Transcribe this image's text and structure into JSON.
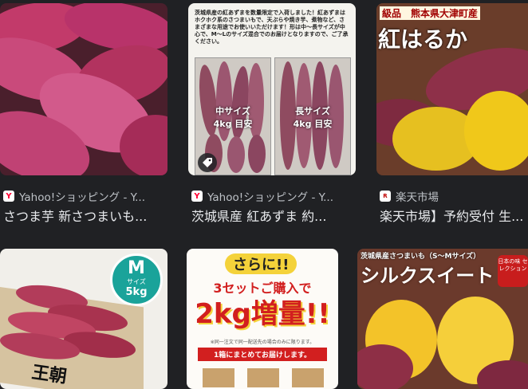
{
  "results": [
    {
      "source": "Yahoo!ショッピング - Y...",
      "source_icon": "yahoo-favicon",
      "title": "さつま芋 新さつまいも..."
    },
    {
      "source": "Yahoo!ショッピング - Y...",
      "source_icon": "yahoo-favicon",
      "title": "茨城県産 紅あずま 約...",
      "image_text": {
        "notice": "茨城県産の紅あずまを数量限定で入荷しました！紅あずまはホクホク系のさつまいもで、天ぷらや焼き芋、煮物など、さまざまな用途でお使いいただけます！形は中～長サイズが中心で、M～Lのサイズ混合でのお届けとなりますので、ご了承ください。",
        "left_label_1": "中サイズ",
        "left_label_2": "4kg 目安",
        "right_label_1": "長サイズ",
        "right_label_2": "4kg 目安"
      }
    },
    {
      "source": "楽天市場",
      "source_icon": "rakuten-favicon",
      "title": "楽天市場】予約受付 生...",
      "image_text": {
        "banner": "級品　熊本県大津町産",
        "big": "紅はるか"
      }
    },
    {
      "image_text": {
        "badge_m": "M",
        "badge_size": "サイズ",
        "badge_kg": "5kg",
        "box_text": "王朝"
      }
    },
    {
      "image_text": {
        "line1": "さらに!!",
        "line2": "3セットご購入で",
        "line3": "2kg増量!!",
        "small": "※同一注文で同一配送先の場合のみに限ります。",
        "ribbon": "1箱にまとめてお届けします。"
      }
    },
    {
      "image_text": {
        "top": "茨城県産さつまいも（S～Mサイズ）",
        "big": "シルクスイート",
        "badge": "日本の味 セレクション"
      }
    }
  ],
  "colors": {
    "background": "#202124",
    "text": "#e8eaed",
    "subtext": "#bdc1c6"
  }
}
